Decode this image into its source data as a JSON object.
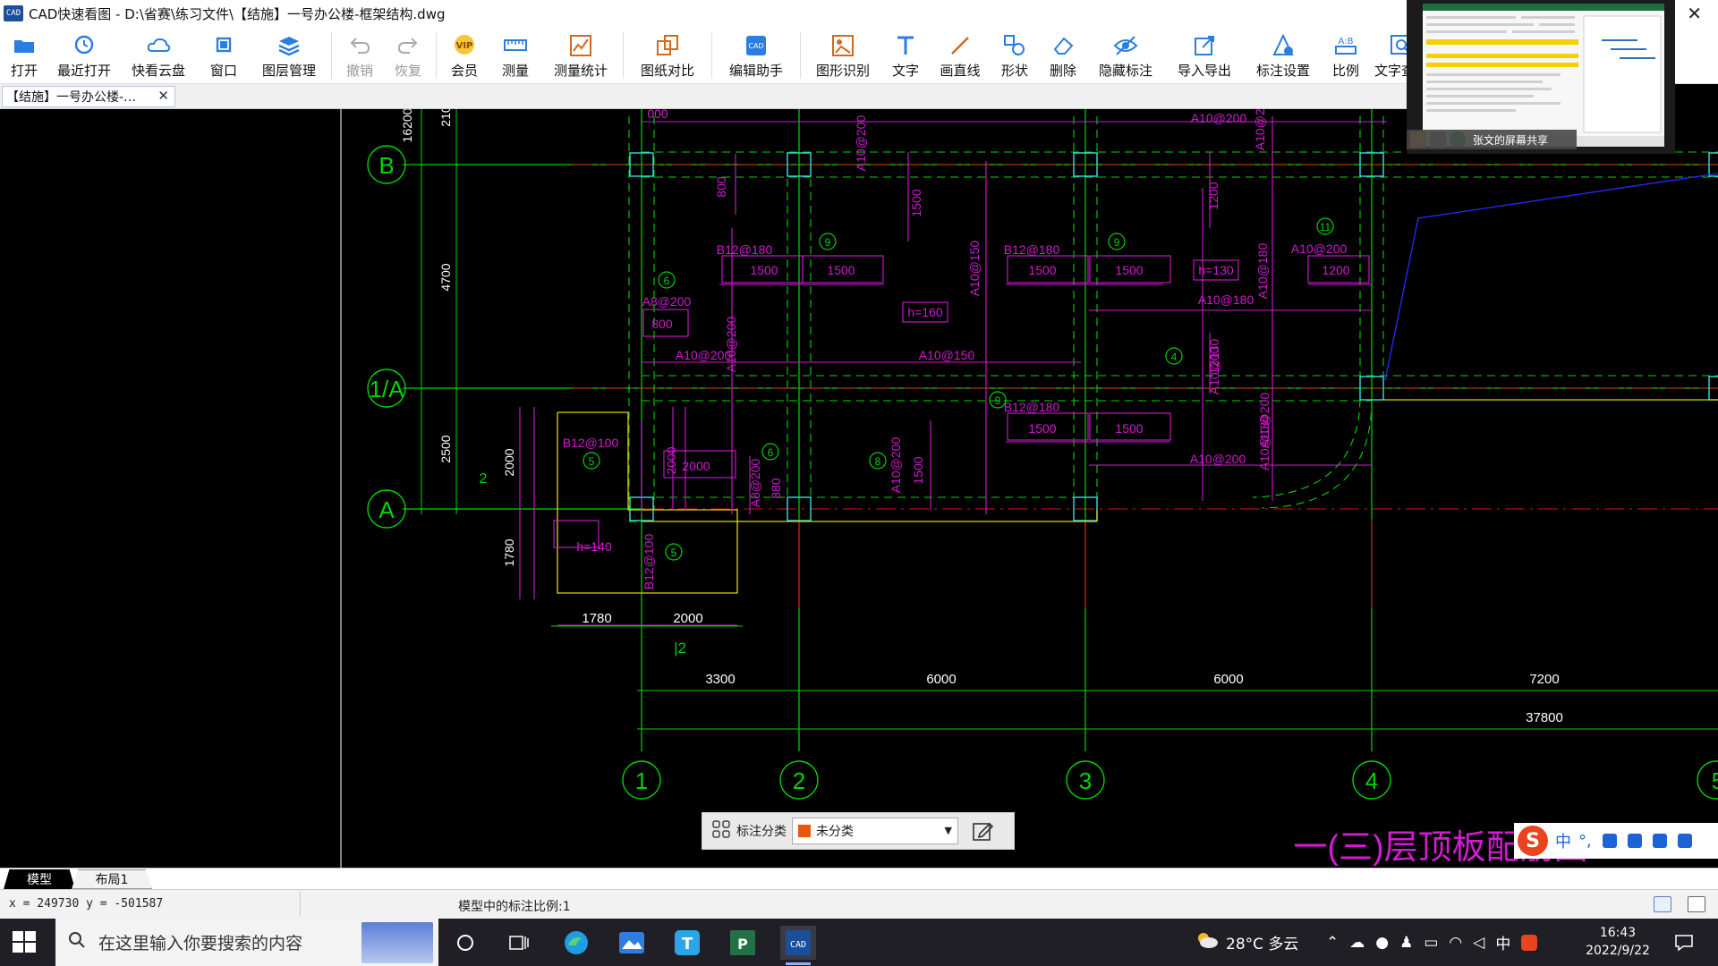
{
  "window": {
    "logo": "CAD",
    "title": "CAD快速看图 - D:\\省赛\\练习文件\\【结施】一号办公楼-框架结构.dwg",
    "close": "✕"
  },
  "toolbar": [
    {
      "label": "打开",
      "icon": "folder-open-icon",
      "enabled": true
    },
    {
      "label": "最近打开",
      "icon": "recent-clock-icon",
      "enabled": true
    },
    {
      "label": "快看云盘",
      "icon": "cloud-icon",
      "enabled": true
    },
    {
      "label": "窗口",
      "icon": "window-icon",
      "enabled": true
    },
    {
      "label": "图层管理",
      "icon": "layers-icon",
      "enabled": true
    },
    {
      "label": "撤销",
      "icon": "undo-icon",
      "enabled": false
    },
    {
      "label": "恢复",
      "icon": "redo-icon",
      "enabled": false
    },
    {
      "label": "会员",
      "icon": "vip-icon",
      "enabled": true
    },
    {
      "label": "测量",
      "icon": "ruler-icon",
      "enabled": true
    },
    {
      "label": "测量统计",
      "icon": "measure-stats-icon",
      "enabled": true
    },
    {
      "label": "图纸对比",
      "icon": "compare-icon",
      "enabled": true
    },
    {
      "label": "编辑助手",
      "icon": "edit-assistant-icon",
      "enabled": true
    },
    {
      "label": "图形识别",
      "icon": "shape-recognition-icon",
      "enabled": true
    },
    {
      "label": "文字",
      "icon": "text-icon",
      "enabled": true
    },
    {
      "label": "画直线",
      "icon": "line-icon",
      "enabled": true
    },
    {
      "label": "形状",
      "icon": "shape-icon",
      "enabled": true
    },
    {
      "label": "删除",
      "icon": "eraser-icon",
      "enabled": true
    },
    {
      "label": "隐藏标注",
      "icon": "hide-eye-icon",
      "enabled": true
    },
    {
      "label": "导入导出",
      "icon": "import-export-icon",
      "enabled": true
    },
    {
      "label": "标注设置",
      "icon": "annotation-settings-icon",
      "enabled": true
    },
    {
      "label": "比例",
      "icon": "scale-icon",
      "enabled": true
    },
    {
      "label": "文字查找",
      "icon": "text-search-icon",
      "enabled": true
    }
  ],
  "doc_tab": {
    "label": "【结施】一号办公楼-…",
    "close": "✕"
  },
  "drawing": {
    "axes_letters": [
      "B",
      "1/A",
      "A"
    ],
    "axes_numbers": [
      "1",
      "2",
      "3",
      "4",
      "5"
    ],
    "dims_bottom": [
      "3300",
      "6000",
      "6000",
      "7200"
    ],
    "dim_total": "37800",
    "dims_left": [
      "16200",
      "210",
      "4700",
      "2500",
      "2000",
      "2",
      "1780"
    ],
    "dims_small": [
      "1780",
      "2000",
      "|2"
    ],
    "annotations": {
      "a1": "A10@200",
      "a2": "A10@200",
      "a3": "A10@200",
      "a4": "000",
      "a5": "800",
      "a6": "1500",
      "a7": "1200",
      "a8": "B12@180",
      "a9": "1500",
      "a10": "1500",
      "a11": "B12@180",
      "a12": "1500",
      "a13": "1500",
      "a14": "h=130",
      "a15": "A10@180",
      "a16": "A10@200",
      "a17": "1200",
      "a18": "A8@200",
      "a19": "800",
      "a20": "A10@200",
      "a21": "h=160",
      "a22": "A10@150",
      "a23": "A10@150",
      "a24": "A10@180",
      "a25": "1200",
      "a26": "A10@200",
      "a27": "B12@180",
      "a28": "1500",
      "a29": "1500",
      "a30": "B12@100",
      "a31": "2000",
      "a32": "2000",
      "a33": "A8@200",
      "a34": "880",
      "a35": "A10@200",
      "a36": "1500",
      "a37": "A10@180",
      "a38": "A10@200",
      "a39": "h=140",
      "a40": "B12@100",
      "a41": "A10@130",
      "a42": "A10@200"
    },
    "circles": [
      "6",
      "9",
      "9",
      "11",
      "4",
      "9",
      "5",
      "6",
      "8",
      "5"
    ],
    "title_text": "一(三)层顶板配筋图"
  },
  "screen_share": {
    "label": "张文的屏幕共享"
  },
  "annotation_bar": {
    "label": "标注分类",
    "selected": "未分类",
    "swatch_color": "#e8570f"
  },
  "ime": {
    "logo": "S",
    "mode": "中",
    "punct": "°,"
  },
  "layout_tabs": [
    "模型",
    "布局1"
  ],
  "status": {
    "coords": "x = 249730  y = -501587",
    "scale": "模型中的标注比例:1"
  },
  "taskbar": {
    "search_placeholder": "在这里输入你要搜索的内容",
    "weather": "28°C  多云",
    "ime_mode": "中",
    "time": "16:43",
    "date": "2022/9/22"
  },
  "colors": {
    "grid": "#00d400",
    "magenta": "#d21bd2",
    "red": "#e01010",
    "yellow": "#d8d600",
    "blue": "#2a2aff",
    "cyan": "#30e0e0"
  }
}
